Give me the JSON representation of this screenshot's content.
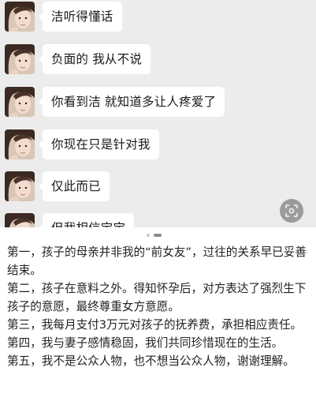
{
  "chat": {
    "messages": [
      {
        "text": "洁听得懂话"
      },
      {
        "text": "负面的 我从不说"
      },
      {
        "text": "你看到洁 就知道多让人疼爱了"
      },
      {
        "text": "你现在只是针对我"
      },
      {
        "text": "仅此而已"
      },
      {
        "text": "但我相信宝宝"
      }
    ],
    "icons": {
      "avatar": "avatar-photo",
      "scan": "image-scan-icon"
    },
    "colors": {
      "background": "#ececec",
      "bubble": "#ffffff"
    }
  },
  "statement": {
    "paragraphs": [
      "第一，孩子的母亲并非我的“前女友”，过往的关系早已妥善结束。",
      "第二，孩子在意料之外。得知怀孕后，对方表达了强烈生下孩子的意愿，最终尊重女方意愿。",
      "第三，我每月支付3万元对孩子的抚养费，承担相应责任。",
      "第四，我与妻子感情稳固，我们共同珍惜现在的生活。",
      "第五，我不是公众人物，也不想当公众人物，谢谢理解。"
    ]
  }
}
